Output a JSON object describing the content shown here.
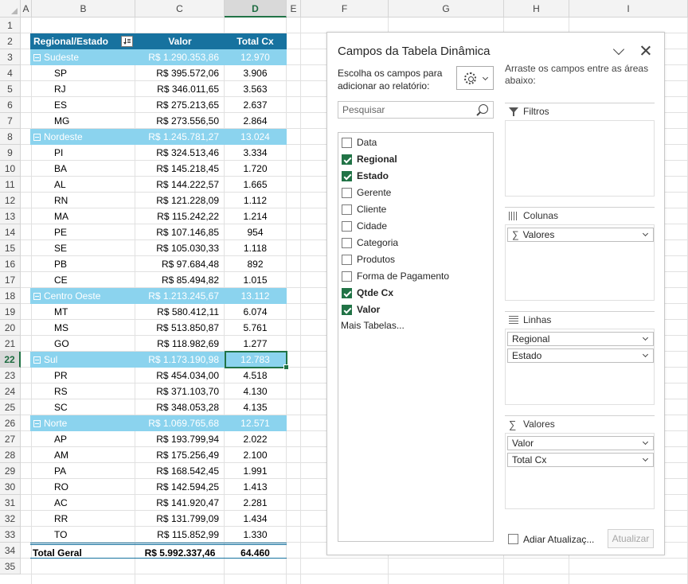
{
  "sheet": {
    "columns": [
      "A",
      "B",
      "C",
      "D",
      "E",
      "F",
      "G",
      "H",
      "I"
    ],
    "rows": [
      "1",
      "2",
      "3",
      "4",
      "5",
      "6",
      "7",
      "8",
      "9",
      "10",
      "11",
      "12",
      "13",
      "14",
      "15",
      "16",
      "17",
      "18",
      "19",
      "20",
      "21",
      "22",
      "23",
      "24",
      "25",
      "26",
      "27",
      "28",
      "29",
      "30",
      "31",
      "32",
      "33",
      "34",
      "35"
    ],
    "selected_column": "D",
    "selected_row": "22"
  },
  "pivot": {
    "headers": {
      "row_label": "Regional/Estado",
      "valor": "Valor",
      "total_cx": "Total Cx"
    },
    "groups": [
      {
        "name": "Sudeste",
        "valor": "R$ 1.290.353,86",
        "total": "12.970",
        "items": [
          {
            "name": "SP",
            "valor": "R$ 395.572,06",
            "total": "3.906"
          },
          {
            "name": "RJ",
            "valor": "R$ 346.011,65",
            "total": "3.563"
          },
          {
            "name": "ES",
            "valor": "R$ 275.213,65",
            "total": "2.637"
          },
          {
            "name": "MG",
            "valor": "R$ 273.556,50",
            "total": "2.864"
          }
        ]
      },
      {
        "name": "Nordeste",
        "valor": "R$ 1.245.781,27",
        "total": "13.024",
        "items": [
          {
            "name": "PI",
            "valor": "R$ 324.513,46",
            "total": "3.334"
          },
          {
            "name": "BA",
            "valor": "R$ 145.218,45",
            "total": "1.720"
          },
          {
            "name": "AL",
            "valor": "R$ 144.222,57",
            "total": "1.665"
          },
          {
            "name": "RN",
            "valor": "R$ 121.228,09",
            "total": "1.112"
          },
          {
            "name": "MA",
            "valor": "R$ 115.242,22",
            "total": "1.214"
          },
          {
            "name": "PE",
            "valor": "R$ 107.146,85",
            "total": "954"
          },
          {
            "name": "SE",
            "valor": "R$ 105.030,33",
            "total": "1.118"
          },
          {
            "name": "PB",
            "valor": "R$ 97.684,48",
            "total": "892"
          },
          {
            "name": "CE",
            "valor": "R$ 85.494,82",
            "total": "1.015"
          }
        ]
      },
      {
        "name": "Centro Oeste",
        "valor": "R$ 1.213.245,67",
        "total": "13.112",
        "items": [
          {
            "name": "MT",
            "valor": "R$ 580.412,11",
            "total": "6.074"
          },
          {
            "name": "MS",
            "valor": "R$ 513.850,87",
            "total": "5.761"
          },
          {
            "name": "GO",
            "valor": "R$ 118.982,69",
            "total": "1.277"
          }
        ]
      },
      {
        "name": "Sul",
        "valor": "R$ 1.173.190,98",
        "total": "12.783",
        "items": [
          {
            "name": "PR",
            "valor": "R$ 454.034,00",
            "total": "4.518"
          },
          {
            "name": "RS",
            "valor": "R$ 371.103,70",
            "total": "4.130"
          },
          {
            "name": "SC",
            "valor": "R$ 348.053,28",
            "total": "4.135"
          }
        ]
      },
      {
        "name": "Norte",
        "valor": "R$ 1.069.765,68",
        "total": "12.571",
        "items": [
          {
            "name": "AP",
            "valor": "R$ 193.799,94",
            "total": "2.022"
          },
          {
            "name": "AM",
            "valor": "R$ 175.256,49",
            "total": "2.100"
          },
          {
            "name": "PA",
            "valor": "R$ 168.542,45",
            "total": "1.991"
          },
          {
            "name": "RO",
            "valor": "R$ 142.594,25",
            "total": "1.413"
          },
          {
            "name": "AC",
            "valor": "R$ 141.920,47",
            "total": "2.281"
          },
          {
            "name": "RR",
            "valor": "R$ 131.799,09",
            "total": "1.434"
          },
          {
            "name": "TO",
            "valor": "R$ 115.852,99",
            "total": "1.330"
          }
        ]
      }
    ],
    "grand_total": {
      "label": "Total Geral",
      "valor": "R$ 5.992.337,46",
      "total": "64.460"
    }
  },
  "field_pane": {
    "title": "Campos da Tabela Dinâmica",
    "choose_fields_text": "Escolha os campos para adicionar ao relatório:",
    "search_placeholder": "Pesquisar",
    "fields": [
      {
        "label": "Data",
        "checked": false
      },
      {
        "label": "Regional",
        "checked": true
      },
      {
        "label": "Estado",
        "checked": true
      },
      {
        "label": "Gerente",
        "checked": false
      },
      {
        "label": "Cliente",
        "checked": false
      },
      {
        "label": "Cidade",
        "checked": false
      },
      {
        "label": "Categoria",
        "checked": false
      },
      {
        "label": "Produtos",
        "checked": false
      },
      {
        "label": "Forma de Pagamento",
        "checked": false
      },
      {
        "label": "Qtde Cx",
        "checked": true
      },
      {
        "label": "Valor",
        "checked": true
      }
    ],
    "more_tables": "Mais Tabelas...",
    "drag_text": "Arraste os campos entre as áreas abaixo:",
    "areas": {
      "filters": {
        "label": "Filtros",
        "items": []
      },
      "columns": {
        "label": "Colunas",
        "items": [
          "Valores"
        ]
      },
      "rows": {
        "label": "Linhas",
        "items": [
          "Regional",
          "Estado"
        ]
      },
      "values": {
        "label": "Valores",
        "items": [
          "Valor",
          "Total Cx"
        ]
      }
    },
    "defer_update_label": "Adiar Atualizaç...",
    "update_button": "Atualizar"
  }
}
